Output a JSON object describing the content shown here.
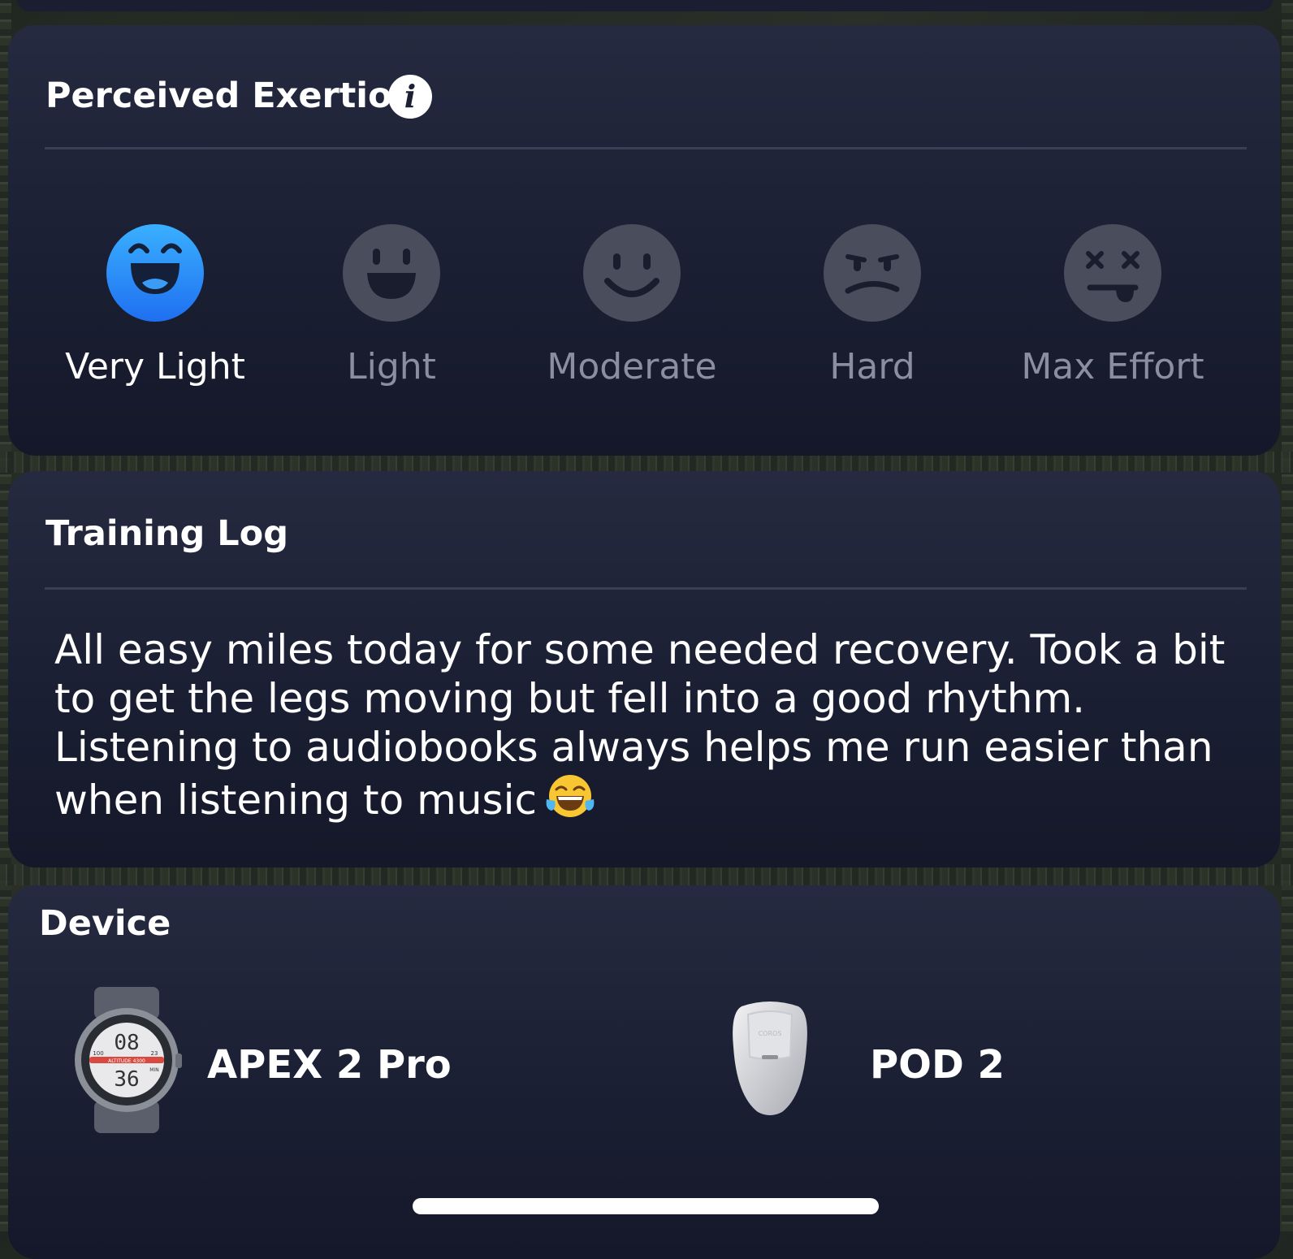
{
  "perceived_exertion": {
    "title": "Perceived Exertion",
    "info_glyph": "i",
    "selected": "Very Light",
    "options": [
      {
        "label": "Very Light",
        "icon": "grinning-face-icon"
      },
      {
        "label": "Light",
        "icon": "happy-face-icon"
      },
      {
        "label": "Moderate",
        "icon": "smiling-face-icon"
      },
      {
        "label": "Hard",
        "icon": "strained-face-icon"
      },
      {
        "label": "Max Effort",
        "icon": "exhausted-face-icon"
      }
    ]
  },
  "training_log": {
    "title": "Training Log",
    "text": "All easy miles today for some needed recovery. Took a bit to get the legs moving but fell into a good rhythm. Listening to audiobooks always helps me run easier than when listening to music",
    "emoji": "tears-of-joy-emoji"
  },
  "device": {
    "title": "Device",
    "items": [
      {
        "name": "APEX 2 Pro",
        "icon": "watch-icon",
        "face_hour": "08",
        "face_minute": "36",
        "face_small_left": "100",
        "face_small_right": "23",
        "face_small_unit": "MIN",
        "face_band": "ALTITUDE 4300"
      },
      {
        "name": "POD 2",
        "icon": "pod-sensor-icon",
        "brand": "COROS"
      }
    ]
  },
  "colors": {
    "selected_face": "#2f8cf5",
    "unselected_face": "#4a4d5c",
    "card_bg": "#1e2237",
    "text_primary": "#ffffff",
    "text_secondary": "#8a8ea0"
  }
}
